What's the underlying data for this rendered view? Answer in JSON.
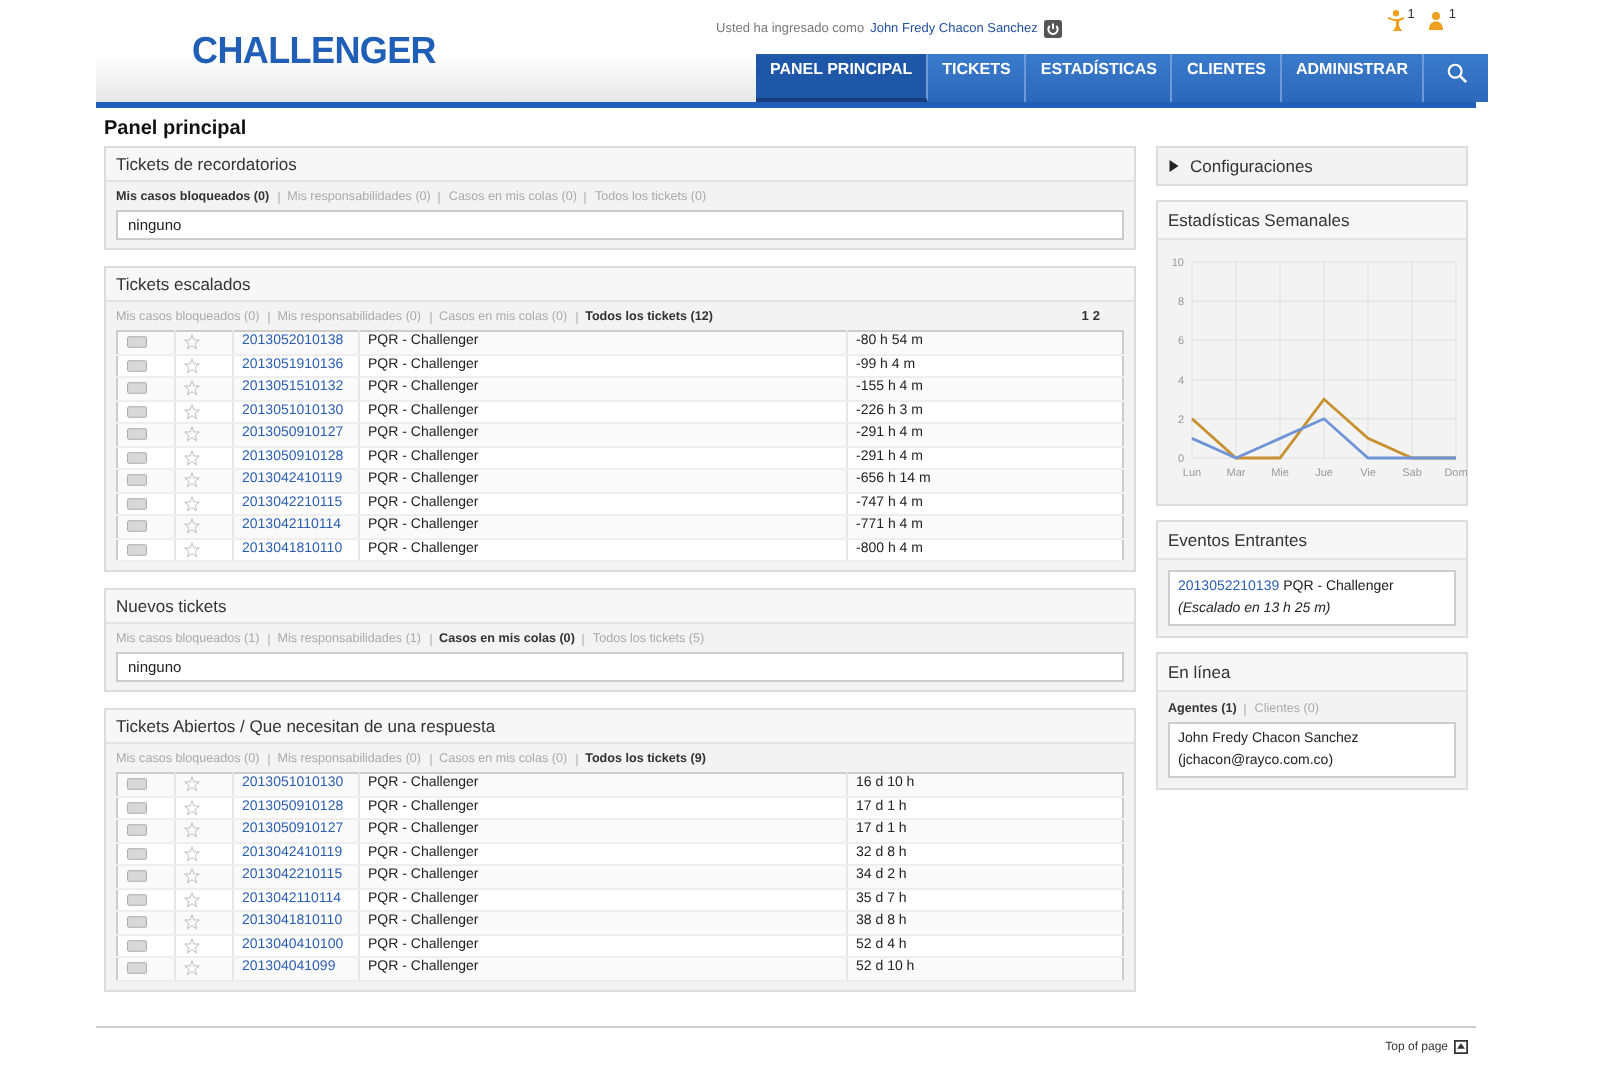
{
  "header": {
    "logo": "CHALLENGER",
    "login_text": "Usted ha ingresado como",
    "user": "John Fredy Chacon Sanchez",
    "notifications": [
      {
        "count": "1"
      },
      {
        "count": "1"
      }
    ]
  },
  "nav": [
    {
      "label": "PANEL PRINCIPAL",
      "selected": true
    },
    {
      "label": "TICKETS",
      "selected": false
    },
    {
      "label": "ESTADÍSTICAS",
      "selected": false
    },
    {
      "label": "CLIENTES",
      "selected": false
    },
    {
      "label": "ADMINISTRAR",
      "selected": false
    }
  ],
  "page_title": "Panel principal",
  "left_panels": [
    {
      "kind": "empty",
      "title": "Tickets de recordatorios",
      "filters": [
        {
          "label": "Mis casos bloqueados (0)",
          "selected": true
        },
        {
          "label": "Mis responsabilidades (0)",
          "selected": false
        },
        {
          "label": "Casos en mis colas (0)",
          "selected": false
        },
        {
          "label": "Todos los tickets (0)",
          "selected": false
        }
      ],
      "empty_text": "ninguno"
    },
    {
      "kind": "table",
      "title": "Tickets escalados",
      "filters": [
        {
          "label": "Mis casos bloqueados (0)",
          "selected": false
        },
        {
          "label": "Mis responsabilidades (0)",
          "selected": false
        },
        {
          "label": "Casos en mis colas (0)",
          "selected": false
        },
        {
          "label": "Todos los tickets (12)",
          "selected": true
        }
      ],
      "pages": [
        "1",
        "2"
      ],
      "rows": [
        {
          "number": "2013052010138",
          "queue": "PQR - Challenger",
          "age": "-80 h 54 m"
        },
        {
          "number": "2013051910136",
          "queue": "PQR - Challenger",
          "age": "-99 h 4 m"
        },
        {
          "number": "2013051510132",
          "queue": "PQR - Challenger",
          "age": "-155 h 4 m"
        },
        {
          "number": "2013051010130",
          "queue": "PQR - Challenger",
          "age": "-226 h 3 m"
        },
        {
          "number": "2013050910127",
          "queue": "PQR - Challenger",
          "age": "-291 h 4 m"
        },
        {
          "number": "2013050910128",
          "queue": "PQR - Challenger",
          "age": "-291 h 4 m"
        },
        {
          "number": "2013042410119",
          "queue": "PQR - Challenger",
          "age": "-656 h 14 m"
        },
        {
          "number": "2013042210115",
          "queue": "PQR - Challenger",
          "age": "-747 h 4 m"
        },
        {
          "number": "2013042110114",
          "queue": "PQR - Challenger",
          "age": "-771 h 4 m"
        },
        {
          "number": "2013041810110",
          "queue": "PQR - Challenger",
          "age": "-800 h 4 m"
        }
      ]
    },
    {
      "kind": "empty",
      "title": "Nuevos tickets",
      "filters": [
        {
          "label": "Mis casos bloqueados (1)",
          "selected": false
        },
        {
          "label": "Mis responsabilidades (1)",
          "selected": false
        },
        {
          "label": "Casos en mis colas (0)",
          "selected": true
        },
        {
          "label": "Todos los tickets (5)",
          "selected": false
        }
      ],
      "empty_text": "ninguno"
    },
    {
      "kind": "table",
      "title": "Tickets Abiertos / Que necesitan de una respuesta",
      "filters": [
        {
          "label": "Mis casos bloqueados (0)",
          "selected": false
        },
        {
          "label": "Mis responsabilidades (0)",
          "selected": false
        },
        {
          "label": "Casos en mis colas (0)",
          "selected": false
        },
        {
          "label": "Todos los tickets (9)",
          "selected": true
        }
      ],
      "rows": [
        {
          "number": "2013051010130",
          "queue": "PQR - Challenger",
          "age": "16 d 10 h"
        },
        {
          "number": "2013050910128",
          "queue": "PQR - Challenger",
          "age": "17 d 1 h"
        },
        {
          "number": "2013050910127",
          "queue": "PQR - Challenger",
          "age": "17 d 1 h"
        },
        {
          "number": "2013042410119",
          "queue": "PQR - Challenger",
          "age": "32 d 8 h"
        },
        {
          "number": "2013042210115",
          "queue": "PQR - Challenger",
          "age": "34 d 2 h"
        },
        {
          "number": "2013042110114",
          "queue": "PQR - Challenger",
          "age": "35 d 7 h"
        },
        {
          "number": "2013041810110",
          "queue": "PQR - Challenger",
          "age": "38 d 8 h"
        },
        {
          "number": "2013040410100",
          "queue": "PQR - Challenger",
          "age": "52 d 4 h"
        },
        {
          "number": "201304041099",
          "queue": "PQR - Challenger",
          "age": "52 d 10 h"
        }
      ]
    }
  ],
  "sidebar": {
    "settings": {
      "label": "Configuraciones",
      "expanded": false
    },
    "stats": {
      "title": "Estadísticas Semanales",
      "chart_data": {
        "type": "line",
        "grid": true,
        "categories": [
          "Lun",
          "Mar",
          "Mie",
          "Jue",
          "Vie",
          "Sab",
          "Dom"
        ],
        "ylim": [
          0,
          10
        ],
        "yticks": [
          0,
          2,
          4,
          6,
          8,
          10
        ],
        "series": [
          {
            "color": "#c8902e",
            "values": [
              2,
              0,
              0,
              3,
              1,
              0,
              0
            ]
          },
          {
            "color": "#6f95d8",
            "values": [
              1,
              0,
              1,
              2,
              0,
              0,
              0
            ]
          }
        ]
      }
    },
    "events": {
      "title": "Eventos Entrantes",
      "number": "2013052210139",
      "queue": "PQR - Challenger",
      "note": "(Escalado en 13 h 25 m)"
    },
    "online": {
      "title": "En línea",
      "filters": [
        {
          "label": "Agentes (1)",
          "selected": true
        },
        {
          "label": "Clientes (0)",
          "selected": false
        }
      ],
      "entries": [
        "John Fredy Chacon Sanchez",
        "(jchacon@rayco.com.co)"
      ]
    }
  },
  "footer": {
    "top_link": "Top of page"
  }
}
